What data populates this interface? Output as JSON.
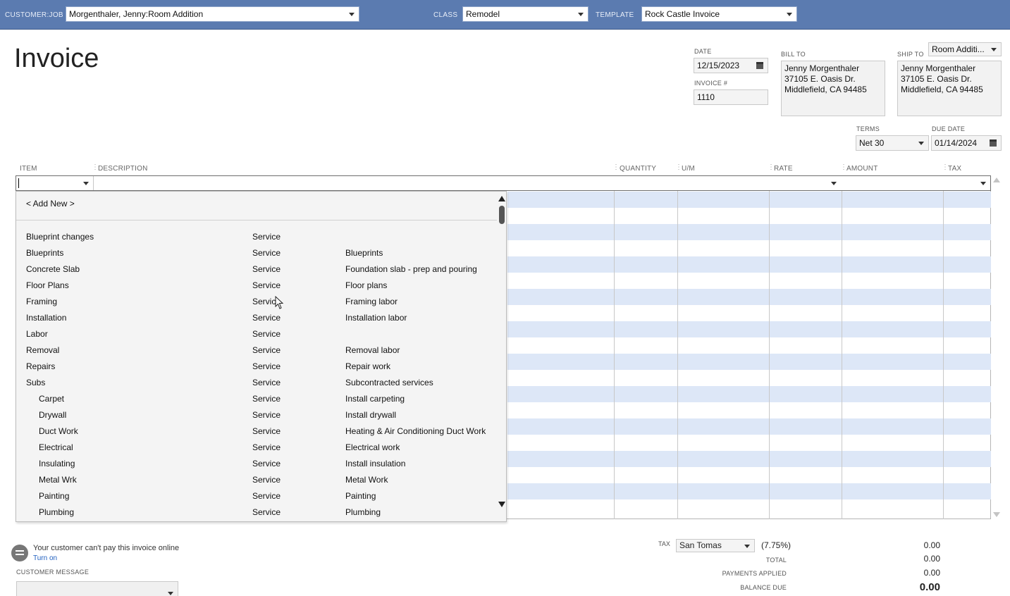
{
  "header": {
    "customer_job_label": "CUSTOMER:JOB",
    "customer_job_value": "Morgenthaler, Jenny:Room Addition",
    "class_label": "CLASS",
    "class_value": "Remodel",
    "template_label": "TEMPLATE",
    "template_value": "Rock Castle Invoice"
  },
  "form": {
    "title": "Invoice",
    "date_label": "DATE",
    "date_value": "12/15/2023",
    "invoice_no_label": "INVOICE #",
    "invoice_no_value": "1110",
    "bill_to_label": "BILL TO",
    "bill_to_lines": [
      "Jenny Morgenthaler",
      "37105 E. Oasis Dr.",
      "Middlefield, CA 94485"
    ],
    "ship_to_label": "SHIP TO",
    "ship_to_select": "Room Additi...",
    "ship_to_lines": [
      "Jenny Morgenthaler",
      "37105 E. Oasis Dr.",
      "Middlefield, CA 94485"
    ],
    "terms_label": "TERMS",
    "terms_value": "Net 30",
    "due_date_label": "DUE DATE",
    "due_date_value": "01/14/2024"
  },
  "table": {
    "columns": [
      "ITEM",
      "DESCRIPTION",
      "QUANTITY",
      "U/M",
      "RATE",
      "AMOUNT",
      "TAX"
    ]
  },
  "item_dropdown": {
    "add_new": "< Add New >",
    "items": [
      {
        "name": "Blueprint changes",
        "type": "Service",
        "desc": "",
        "sub": false
      },
      {
        "name": "Blueprints",
        "type": "Service",
        "desc": "Blueprints",
        "sub": false
      },
      {
        "name": "Concrete Slab",
        "type": "Service",
        "desc": "Foundation slab - prep and pouring",
        "sub": false
      },
      {
        "name": "Floor Plans",
        "type": "Service",
        "desc": "Floor plans",
        "sub": false
      },
      {
        "name": "Framing",
        "type": "Service",
        "desc": "Framing labor",
        "sub": false
      },
      {
        "name": "Installation",
        "type": "Service",
        "desc": "Installation labor",
        "sub": false
      },
      {
        "name": "Labor",
        "type": "Service",
        "desc": "",
        "sub": false
      },
      {
        "name": "Removal",
        "type": "Service",
        "desc": "Removal labor",
        "sub": false
      },
      {
        "name": "Repairs",
        "type": "Service",
        "desc": "Repair work",
        "sub": false
      },
      {
        "name": "Subs",
        "type": "Service",
        "desc": "Subcontracted services",
        "sub": false
      },
      {
        "name": "Carpet",
        "type": "Service",
        "desc": "Install carpeting",
        "sub": true
      },
      {
        "name": "Drywall",
        "type": "Service",
        "desc": "Install drywall",
        "sub": true
      },
      {
        "name": "Duct Work",
        "type": "Service",
        "desc": "Heating & Air Conditioning Duct Work",
        "sub": true
      },
      {
        "name": "Electrical",
        "type": "Service",
        "desc": "Electrical work",
        "sub": true
      },
      {
        "name": "Insulating",
        "type": "Service",
        "desc": "Install insulation",
        "sub": true
      },
      {
        "name": "Metal Wrk",
        "type": "Service",
        "desc": "Metal Work",
        "sub": true
      },
      {
        "name": "Painting",
        "type": "Service",
        "desc": "Painting",
        "sub": true
      },
      {
        "name": "Plumbing",
        "type": "Service",
        "desc": "Plumbing",
        "sub": true
      }
    ]
  },
  "footer": {
    "online_pay_text": "Your customer can't pay this invoice online",
    "turn_on_link": "Turn on",
    "customer_message_label": "CUSTOMER MESSAGE",
    "tax_label": "TAX",
    "tax_value": "San Tomas",
    "tax_pct": "(7.75%)",
    "tax_amount": "0.00",
    "total_label": "TOTAL",
    "total_value": "0.00",
    "payments_applied_label": "PAYMENTS APPLIED",
    "payments_applied_value": "0.00",
    "balance_due_label": "BALANCE DUE",
    "balance_due_value": "0.00"
  },
  "colors": {
    "topbar": "#5b7bb0",
    "row_stripe": "#dde7f7",
    "link": "#1f5fbf"
  }
}
